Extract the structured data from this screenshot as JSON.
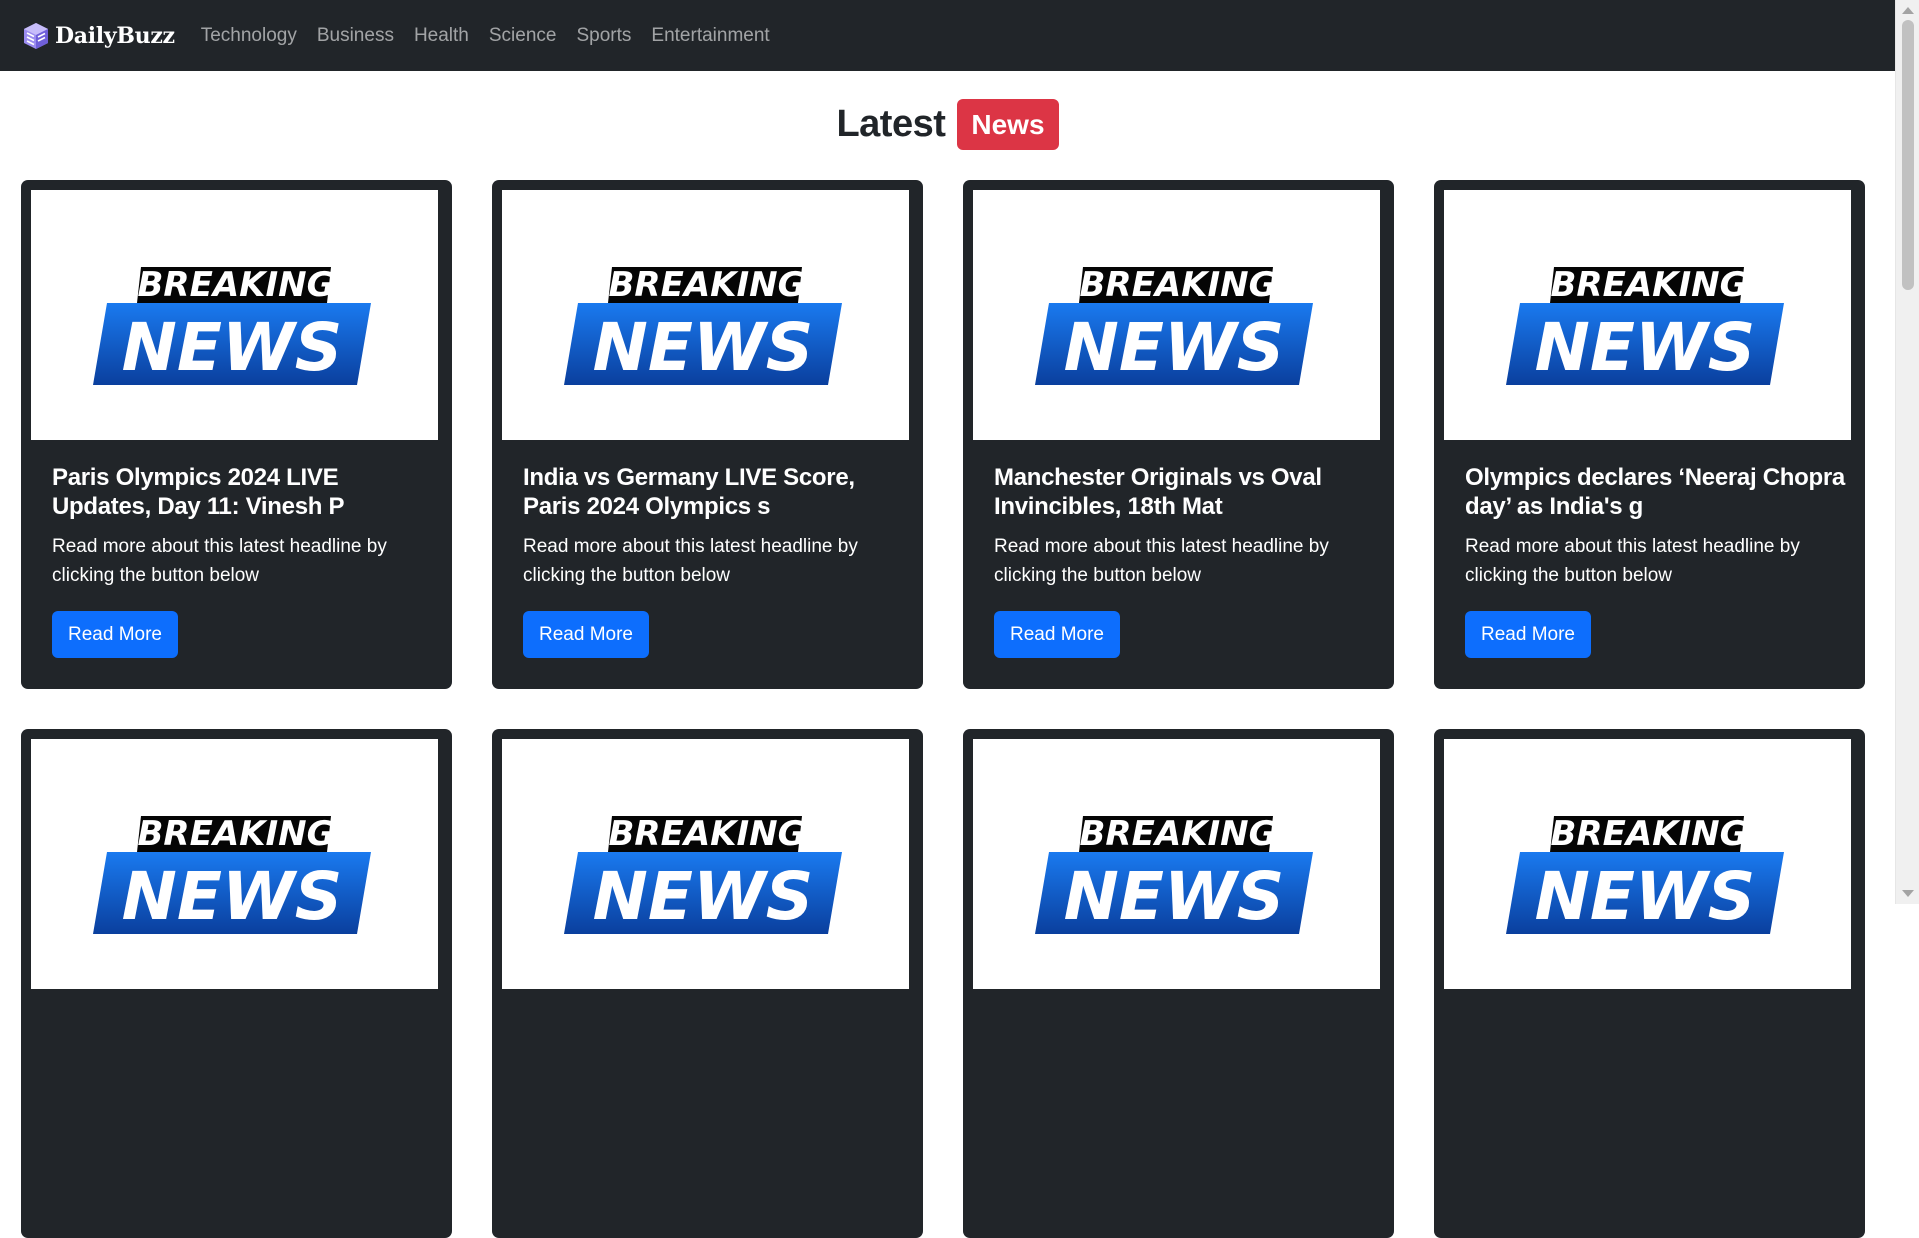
{
  "navbar": {
    "brand": "DailyBuzz",
    "links": [
      "Technology",
      "Business",
      "Health",
      "Science",
      "Sports",
      "Entertainment"
    ]
  },
  "heading": {
    "text": "Latest",
    "badge": "News"
  },
  "image": {
    "line1": "BREAKING",
    "line2": "NEWS"
  },
  "cards": [
    {
      "title": "Paris Olympics 2024 LIVE Updates, Day 11: Vinesh P",
      "description": "Read more about this latest headline by clicking the button below",
      "button": "Read More"
    },
    {
      "title": "India vs Germany LIVE Score, Paris 2024 Olympics s",
      "description": "Read more about this latest headline by clicking the button below",
      "button": "Read More"
    },
    {
      "title": "Manchester Originals vs Oval Invincibles, 18th Mat",
      "description": "Read more about this latest headline by clicking the button below",
      "button": "Read More"
    },
    {
      "title": "Olympics declares ‘Neeraj Chopra day’ as India's g",
      "description": "Read more about this latest headline by clicking the button below",
      "button": "Read More"
    },
    {
      "title": "",
      "description": "",
      "button": ""
    },
    {
      "title": "",
      "description": "",
      "button": ""
    },
    {
      "title": "",
      "description": "",
      "button": ""
    },
    {
      "title": "",
      "description": "",
      "button": ""
    }
  ],
  "colors": {
    "navbar_bg": "#212529",
    "card_bg": "#212529",
    "badge": "#dc3545",
    "button": "#0d6efd",
    "breaking_blue": "#0b5bd3"
  }
}
